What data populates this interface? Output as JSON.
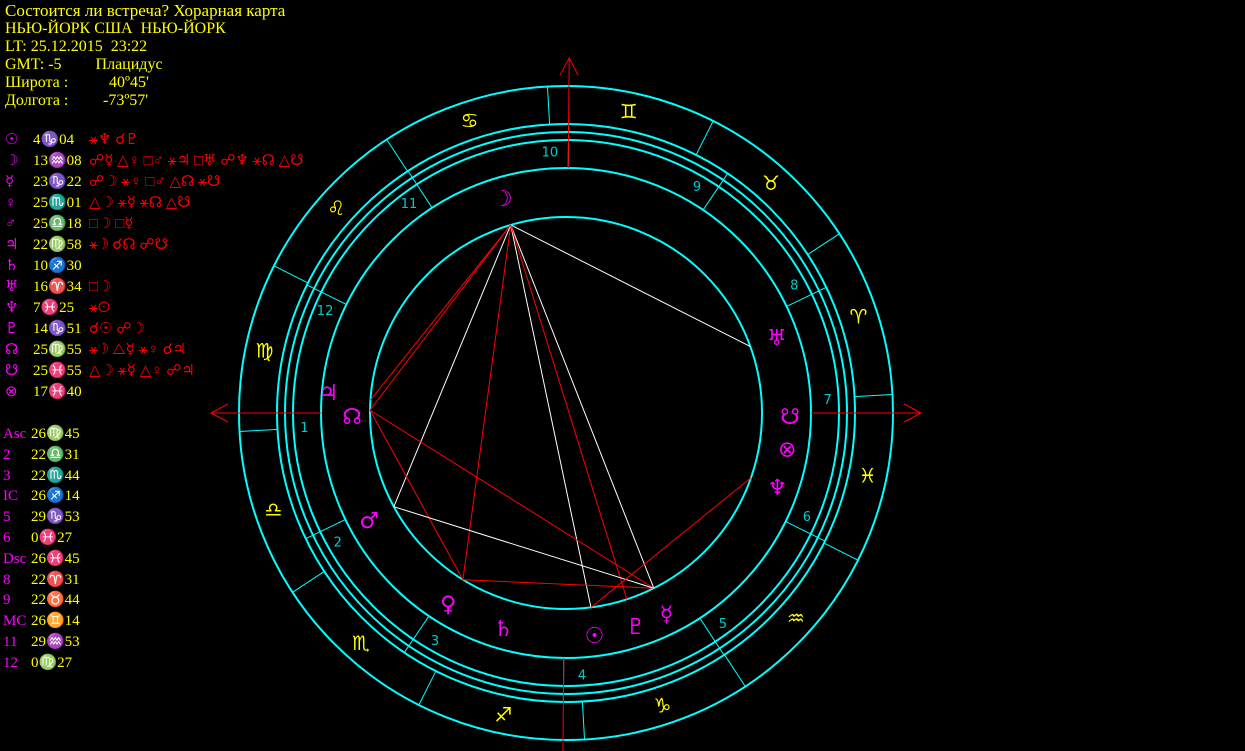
{
  "header": {
    "title": "Состоится ли встреча? Хорарная карта",
    "location": "НЬЮ-ЙОРК США  НЬЮ-ЙОРК",
    "local_time": "LT: 25.12.2015  23:22",
    "gmt": "GMT: -5",
    "house_system": "Плацидус",
    "latitude_label": "Широта :",
    "latitude_value": "40º45'",
    "longitude_label": "Долгота :",
    "longitude_value": "-73º57'"
  },
  "planets": [
    {
      "glyph": "☉",
      "pos": "4♑04",
      "aspects": "⚹♆ ☌♇"
    },
    {
      "glyph": "☽",
      "pos": "13♒08",
      "aspects": "☍☿ △♀ □♂ ⚹♃ □♅ ☍♆ ⚹☊ △☋"
    },
    {
      "glyph": "☿",
      "pos": "23♑22",
      "aspects": "☍☽ ⚹♀ □♂ △☊ ⚹☋"
    },
    {
      "glyph": "♀",
      "pos": "25♏01",
      "aspects": "△☽ ⚹☿ ⚹☊ △☋"
    },
    {
      "glyph": "♂",
      "pos": "25♎18",
      "aspects": "□☽ □☿"
    },
    {
      "glyph": "♃",
      "pos": "22♍58",
      "aspects": "⚹☽ ☌☊ ☍☋"
    },
    {
      "glyph": "♄",
      "pos": "10♐30",
      "aspects": ""
    },
    {
      "glyph": "♅",
      "pos": "16♈34",
      "aspects": "□☽"
    },
    {
      "glyph": "♆",
      "pos": "7♓25",
      "aspects": "⚹☉"
    },
    {
      "glyph": "♇",
      "pos": "14♑51",
      "aspects": "☌☉ ☍☽"
    },
    {
      "glyph": "☊",
      "pos": "25♍55",
      "aspects": "⚹☽ △☿ ⚹♀ ☌♃"
    },
    {
      "glyph": "☋",
      "pos": "25♓55",
      "aspects": "△☽ ⚹☿ △♀ ☍♃"
    },
    {
      "glyph": "⊗",
      "pos": "17♓40",
      "aspects": ""
    }
  ],
  "cusps": [
    {
      "label": "Asc",
      "pos": "26♍45"
    },
    {
      "label": "2",
      "pos": "22♎31"
    },
    {
      "label": "3",
      "pos": "22♏44"
    },
    {
      "label": "IC",
      "pos": "26♐14"
    },
    {
      "label": "5",
      "pos": "29♑53"
    },
    {
      "label": "6",
      "pos": "0♓27"
    },
    {
      "label": "Dsc",
      "pos": "26♓45"
    },
    {
      "label": "8",
      "pos": "22♈31"
    },
    {
      "label": "9",
      "pos": "22♉44"
    },
    {
      "label": "MC",
      "pos": "26♊14"
    },
    {
      "label": "11",
      "pos": "29♒53"
    },
    {
      "label": "12",
      "pos": "0♍27"
    }
  ],
  "wheel": {
    "asc_longitude": 176.75,
    "sign_glyphs": [
      "♈",
      "♉",
      "♊",
      "♋",
      "♌",
      "♍",
      "♎",
      "♏",
      "♐",
      "♑",
      "♒",
      "♓"
    ],
    "house_cusps": [
      {
        "num": "1",
        "lon": 176.75
      },
      {
        "num": "2",
        "lon": 202.52
      },
      {
        "num": "3",
        "lon": 232.73
      },
      {
        "num": "4",
        "lon": 266.23
      },
      {
        "num": "5",
        "lon": 299.88
      },
      {
        "num": "6",
        "lon": 330.45
      },
      {
        "num": "7",
        "lon": 356.75
      },
      {
        "num": "8",
        "lon": 22.52
      },
      {
        "num": "9",
        "lon": 52.73
      },
      {
        "num": "10",
        "lon": 86.23
      },
      {
        "num": "11",
        "lon": 119.88
      },
      {
        "num": "12",
        "lon": 150.45
      }
    ],
    "bodies": [
      {
        "name": "sun",
        "glyph": "☉",
        "lon": 274.07
      },
      {
        "name": "moon",
        "glyph": "☽",
        "lon": 103.13
      },
      {
        "name": "mercury",
        "glyph": "☿",
        "lon": 293.37
      },
      {
        "name": "venus",
        "glyph": "♀",
        "lon": 235.02
      },
      {
        "name": "mars",
        "glyph": "♂",
        "lon": 205.3
      },
      {
        "name": "jupiter",
        "glyph": "♃",
        "lon": 172.97
      },
      {
        "name": "saturn",
        "glyph": "♄",
        "lon": 250.5
      },
      {
        "name": "uranus",
        "glyph": "♅",
        "lon": 16.57
      },
      {
        "name": "neptune",
        "glyph": "♆",
        "lon": 337.42
      },
      {
        "name": "pluto",
        "glyph": "♇",
        "lon": 284.85
      },
      {
        "name": "north-node",
        "glyph": "☊",
        "lon": 175.92
      },
      {
        "name": "south-node",
        "glyph": "☋",
        "lon": 355.92
      },
      {
        "name": "fortune",
        "glyph": "⊗",
        "lon": 347.67
      }
    ],
    "aspect_lines": [
      {
        "from": 103.13,
        "to": 235.02,
        "color": "#ff0000"
      },
      {
        "from": 103.13,
        "to": 205.3,
        "color": "#ffffff"
      },
      {
        "from": 103.13,
        "to": 293.37,
        "color": "#ffffff"
      },
      {
        "from": 103.13,
        "to": 274.07,
        "color": "#ffffff"
      },
      {
        "from": 103.13,
        "to": 16.57,
        "color": "#ffffff"
      },
      {
        "from": 103.13,
        "to": 175.92,
        "color": "#ff0000"
      },
      {
        "from": 103.13,
        "to": 172.97,
        "color": "#ff0000"
      },
      {
        "from": 103.13,
        "to": 284.85,
        "color": "#ff0000"
      },
      {
        "from": 175.92,
        "to": 293.37,
        "color": "#ff0000"
      },
      {
        "from": 175.92,
        "to": 235.02,
        "color": "#ff0000"
      },
      {
        "from": 235.02,
        "to": 293.37,
        "color": "#ff0000"
      },
      {
        "from": 293.37,
        "to": 205.3,
        "color": "#ffffff"
      },
      {
        "from": 274.07,
        "to": 337.42,
        "color": "#ff0000"
      }
    ],
    "colors": {
      "ring": "#00ffff",
      "axis": "#ff0000",
      "sign_glyph": "#ffff00",
      "planet_glyph": "#ff00ff",
      "house_number": "#00cccc"
    }
  }
}
